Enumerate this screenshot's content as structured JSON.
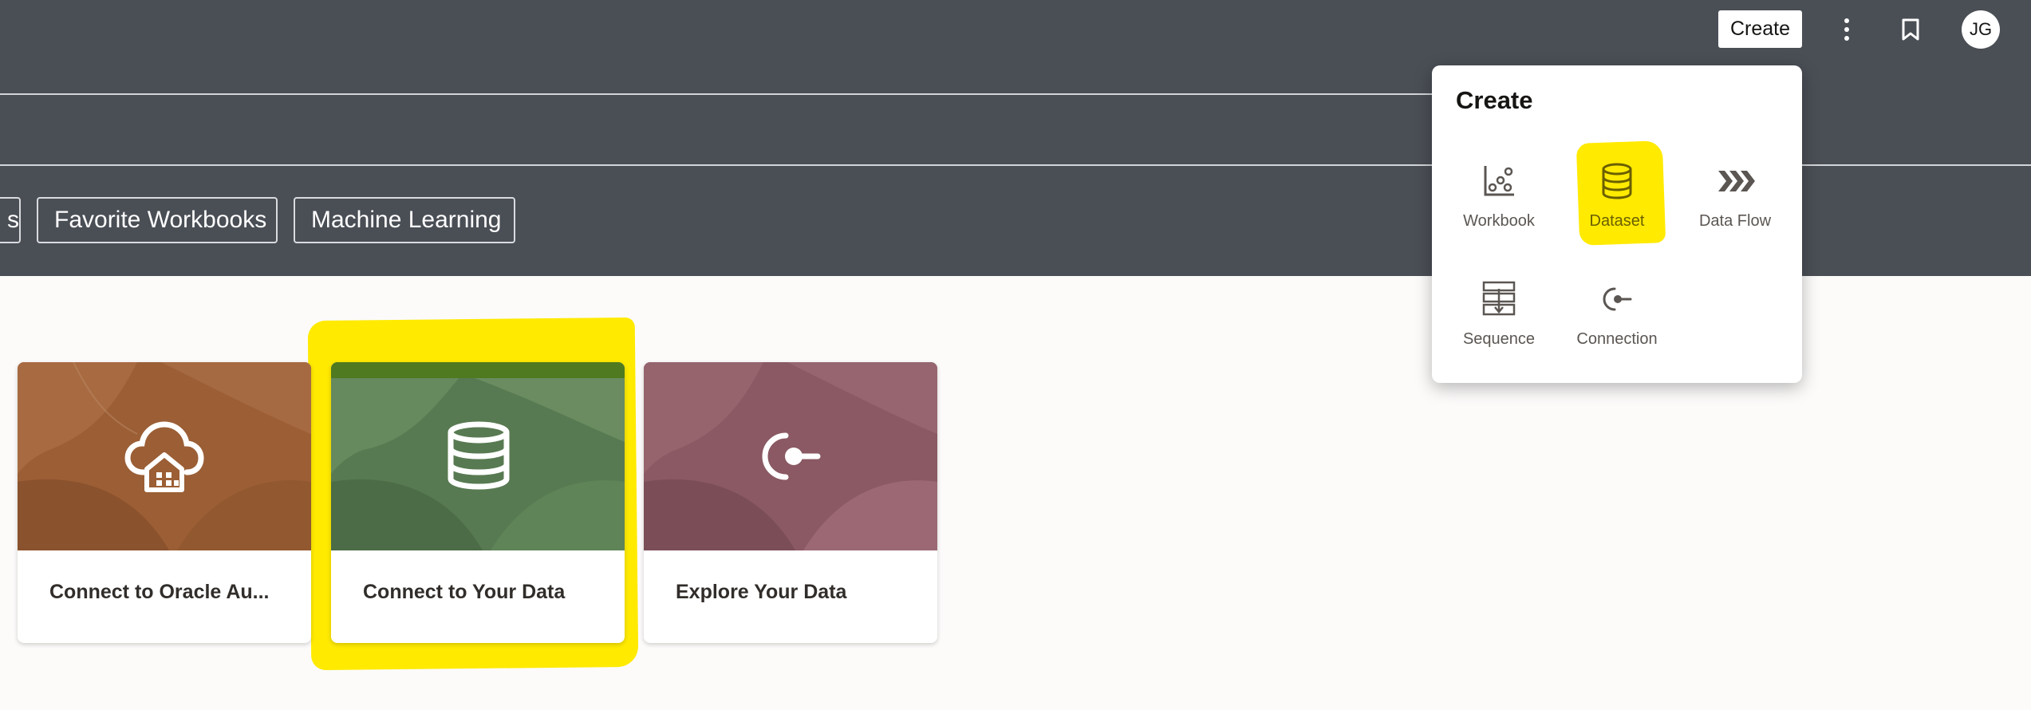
{
  "header": {
    "chips": [
      "s",
      "Favorite Workbooks",
      "Machine Learning"
    ],
    "create_label": "Create",
    "avatar_initials": "JG"
  },
  "create_menu": {
    "title": "Create",
    "items": [
      {
        "label": "Workbook",
        "icon": "workbook-icon"
      },
      {
        "label": "Dataset",
        "icon": "dataset-icon",
        "highlighted": true
      },
      {
        "label": "Data Flow",
        "icon": "data-flow-icon"
      },
      {
        "label": "Sequence",
        "icon": "sequence-icon"
      },
      {
        "label": "Connection",
        "icon": "connection-icon"
      }
    ]
  },
  "cards": [
    {
      "title": "Connect to Oracle Au...",
      "icon": "cloud-warehouse-icon",
      "color": "#9b5e35"
    },
    {
      "title": "Connect to Your Data",
      "icon": "database-icon",
      "color": "#587a52",
      "highlighted": true
    },
    {
      "title": "Explore Your Data",
      "icon": "connection-plug-icon",
      "color": "#8a5963"
    }
  ],
  "colors": {
    "header_bg": "#4a4e55",
    "page_bg": "#fcfbfa",
    "highlight": "#ffea00"
  }
}
